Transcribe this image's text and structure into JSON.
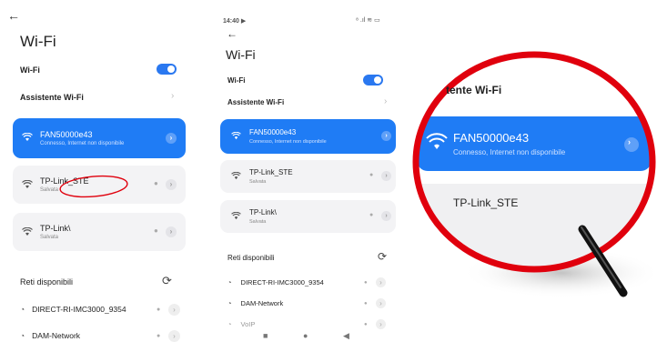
{
  "settings": {
    "back_glyph": "←",
    "page_title": "Wi-Fi",
    "wifi_toggle_label": "Wi-Fi",
    "assistant_label": "Assistente Wi-Fi",
    "available_label": "Reti disponibili",
    "refresh_glyph": "⟳",
    "chevron_glyph": "›"
  },
  "networks": {
    "connected": {
      "name": "FAN50000e43",
      "status": "Connesso, Internet non disponibile"
    },
    "saved": [
      {
        "name": "TP-Link_STE",
        "status": "Salvata"
      },
      {
        "name": "TP-Link\\",
        "status": "Salvata"
      }
    ],
    "available": [
      {
        "name": "DIRECT-RI-IMC3000_9354"
      },
      {
        "name": "DAM-Network"
      },
      {
        "name": "VoIP"
      }
    ]
  },
  "status_bar": {
    "time": "14:40",
    "play_glyph": "▶",
    "icons": "⁸ .ıl ≋ ▭"
  },
  "nav_bar": {
    "square": "■",
    "circle": "●",
    "back": "◀"
  },
  "zoom": {
    "header_fragment": "tente Wi-Fi",
    "card_name": "FAN50000e43",
    "card_status": "Connesso, Internet non disponibile",
    "saved_name": "TP-Link_STE"
  },
  "colors": {
    "accent": "#1f7cf5",
    "highlight_ring": "#e0000d",
    "magnifier_handle": "#111111"
  },
  "icons": [
    "back-arrow-icon",
    "wifi-icon",
    "lock-icon",
    "chevron-right-icon",
    "refresh-icon",
    "magnifier-icon"
  ]
}
